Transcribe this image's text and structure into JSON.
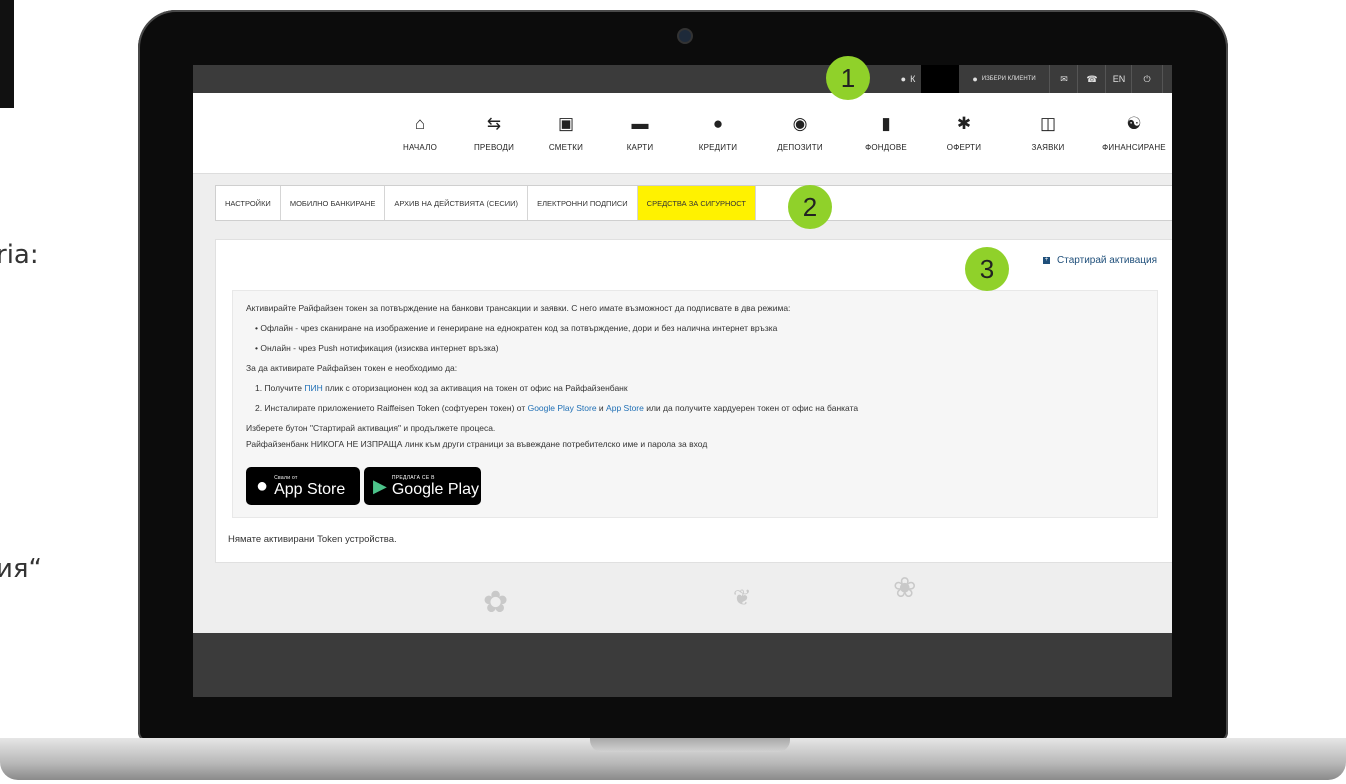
{
  "side_text": {
    "top": "ria:",
    "bottom": "ия“"
  },
  "topbar": {
    "user_initial": "К",
    "choose_clients": "ИЗБЕРИ КЛИЕНТИ",
    "language": "EN",
    "icons": [
      "user-icon",
      "users-icon",
      "mail-icon",
      "phone-icon",
      "power-icon"
    ]
  },
  "nav": {
    "items": [
      {
        "label": "НАЧАЛО",
        "icon": "home-icon"
      },
      {
        "label": "ПРЕВОДИ",
        "icon": "transfer-icon"
      },
      {
        "label": "СМЕТКИ",
        "icon": "wallet-icon"
      },
      {
        "label": "КАРТИ",
        "icon": "card-icon"
      },
      {
        "label": "КРЕДИТИ",
        "icon": "money-bag-icon"
      },
      {
        "label": "ДЕПОЗИТИ",
        "icon": "piggy-bank-icon"
      },
      {
        "label": "ФОНДОВЕ",
        "icon": "chart-icon"
      },
      {
        "label": "ОФЕРТИ",
        "icon": "badge-icon"
      },
      {
        "label": "ЗАЯВКИ",
        "icon": "document-plus-icon"
      },
      {
        "label": "ФИНАНСИРАНЕ",
        "icon": "handshake-icon"
      }
    ]
  },
  "tabs": [
    {
      "label": "НАСТРОЙКИ",
      "active": false
    },
    {
      "label": "МОБИЛНО БАНКИРАНЕ",
      "active": false
    },
    {
      "label": "АРХИВ НА ДЕЙСТВИЯТА (СЕСИИ)",
      "active": false
    },
    {
      "label": "ЕЛЕКТРОННИ ПОДПИСИ",
      "active": false
    },
    {
      "label": "СРЕДСТВА ЗА СИГУРНОСТ",
      "active": true
    }
  ],
  "panel": {
    "start_activation": "Стартирай активация",
    "intro": "Активирайте Райфайзен токен за потвърждение на банкови трансакции и заявки. С него имате възможност да подписвате в два режима:",
    "bullet1": "Офлайн - чрез сканиране на изображение и генериране на еднократен код за потвърждение, дори и без налична интернет връзка",
    "bullet2": "Онлайн - чрез Push нотификация (изисква интернет връзка)",
    "required": "За да активирате Райфайзен токен е необходимо да:",
    "step1_pre": "1. Получите ",
    "step1_link": "ПИН",
    "step1_post": " плик с оторизационен код за активация на токен от офис на Райфайзенбанк",
    "step2_pre": "2. Инсталирате приложението Raiffeisen Token (софтуерен токен) от ",
    "step2_link1": "Google Play Store",
    "step2_mid": " и ",
    "step2_link2": "App Store",
    "step2_post": " или да получите хардуерен токен от офис на банката",
    "choose": "Изберете бутон \"Стартирай активация\" и продължете процеса.",
    "warning": "Райфайзенбанк НИКОГА НЕ ИЗПРАЩА линк към други страници за въвеждане потребителско име и парола за вход",
    "app_store_small": "Свали от",
    "app_store_big": "App Store",
    "google_play_small": "ПРЕДЛАГА СЕ В",
    "google_play_big": "Google Play",
    "no_token": "Нямате активирани Token устройства."
  },
  "badges": [
    "1",
    "2",
    "3"
  ],
  "colors": {
    "accent_yellow": "#fff200",
    "badge_green": "#90d12a",
    "topbar": "#3b3b3b",
    "link": "#1f6fb5"
  }
}
